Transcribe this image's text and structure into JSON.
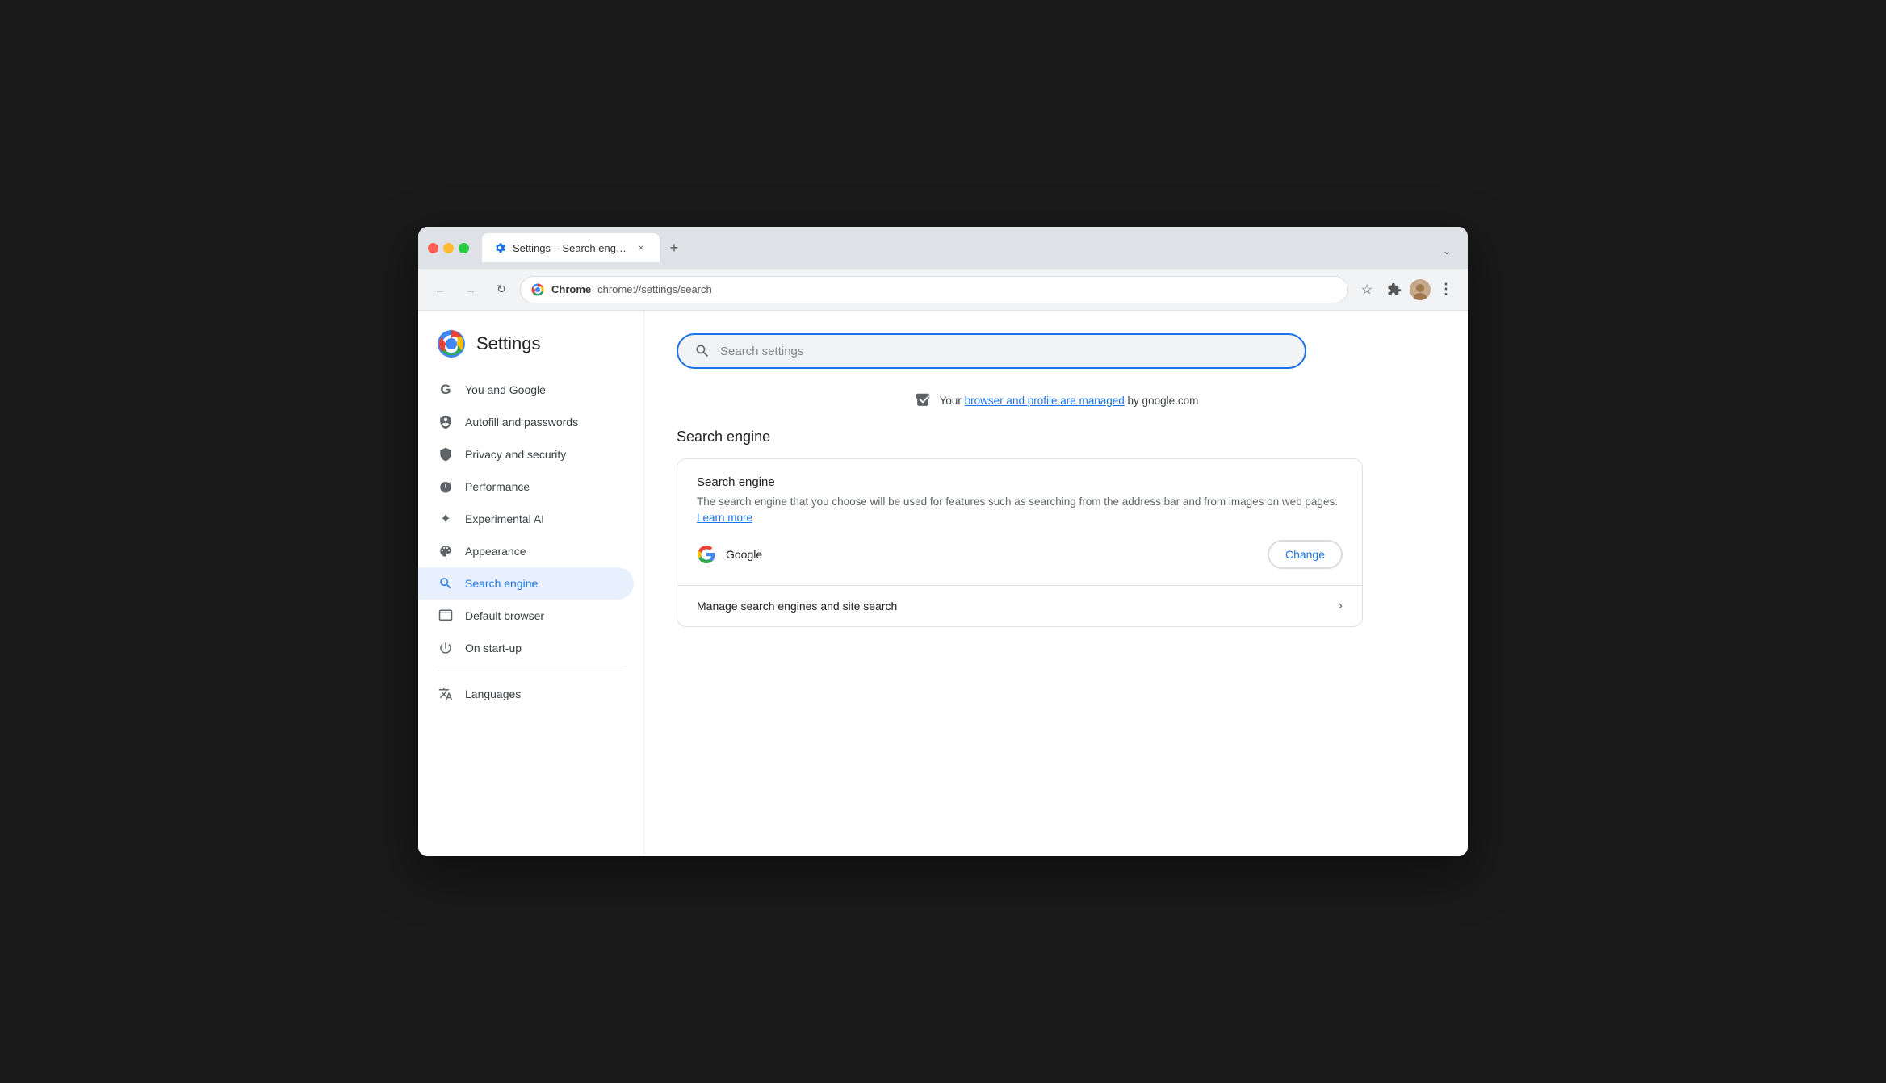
{
  "window": {
    "title": "Settings – Search engine",
    "tab_label": "Settings – Search engine",
    "tab_close": "×",
    "tab_new": "+",
    "tab_dropdown": "⌄"
  },
  "toolbar": {
    "back_label": "←",
    "forward_label": "→",
    "reload_label": "↻",
    "site_label": "Chrome",
    "url": "chrome://settings/search",
    "bookmark_label": "☆",
    "extensions_label": "🧩",
    "menu_label": "⋮"
  },
  "sidebar": {
    "app_title": "Settings",
    "nav_items": [
      {
        "id": "you-and-google",
        "label": "You and Google",
        "icon": "G"
      },
      {
        "id": "autofill",
        "label": "Autofill and passwords",
        "icon": "🔑"
      },
      {
        "id": "privacy",
        "label": "Privacy and security",
        "icon": "🛡"
      },
      {
        "id": "performance",
        "label": "Performance",
        "icon": "📊"
      },
      {
        "id": "experimental-ai",
        "label": "Experimental AI",
        "icon": "✦"
      },
      {
        "id": "appearance",
        "label": "Appearance",
        "icon": "🎨"
      },
      {
        "id": "search-engine",
        "label": "Search engine",
        "icon": "🔍",
        "active": true
      },
      {
        "id": "default-browser",
        "label": "Default browser",
        "icon": "⬜"
      },
      {
        "id": "on-startup",
        "label": "On start-up",
        "icon": "⏻"
      }
    ],
    "nav_items_bottom": [
      {
        "id": "languages",
        "label": "Languages",
        "icon": "A̷"
      }
    ]
  },
  "content": {
    "search_placeholder": "Search settings",
    "managed_notice_prefix": "Your ",
    "managed_notice_link": "browser and profile are managed",
    "managed_notice_suffix": " by google.com",
    "section_title": "Search engine",
    "card": {
      "section1": {
        "title": "Search engine",
        "desc_prefix": "The search engine that you choose will be used for features such as searching from the address bar and from images on web pages. ",
        "desc_link": "Learn more",
        "engine_name": "Google",
        "change_btn_label": "Change"
      },
      "section2": {
        "label": "Manage search engines and site search",
        "chevron": "›"
      }
    }
  }
}
